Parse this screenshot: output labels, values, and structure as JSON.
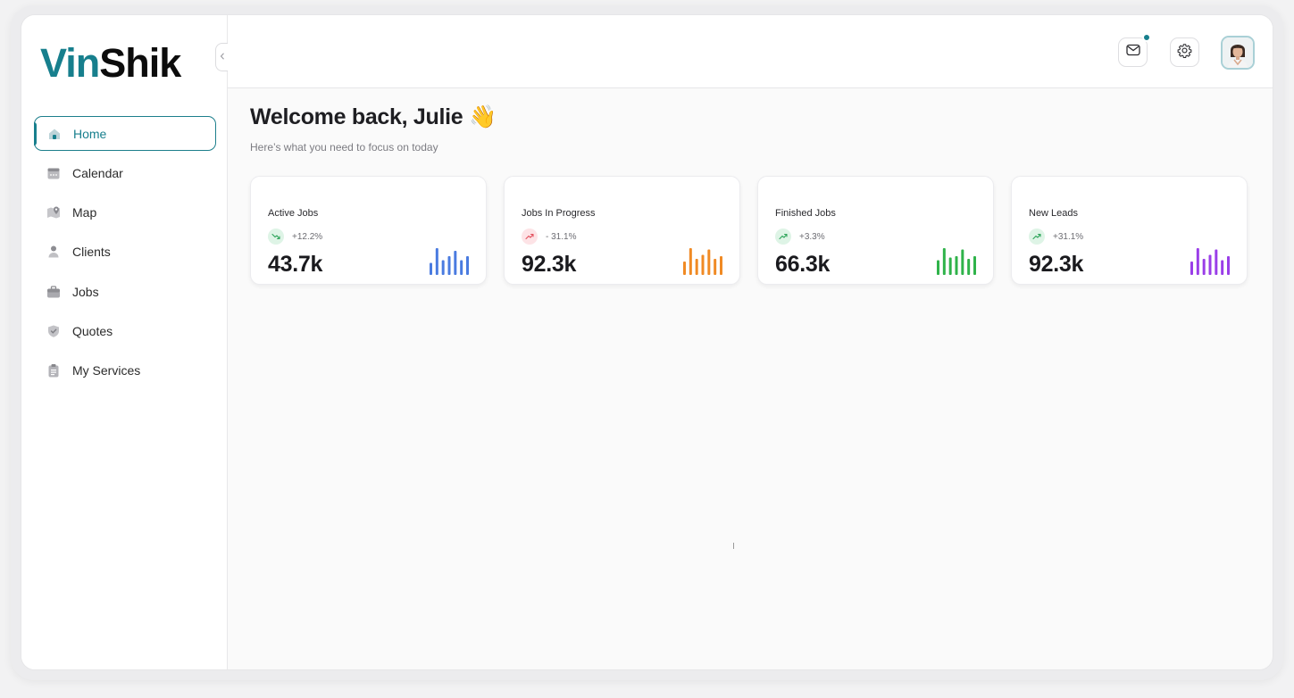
{
  "app": {
    "logo_part1": "Vin",
    "logo_part2": "Shik",
    "accent": "#177f8d"
  },
  "sidebar": {
    "collapse_icon": "chevron-left-icon",
    "items": [
      {
        "label": "Home",
        "icon": "home-icon",
        "active": true
      },
      {
        "label": "Calendar",
        "icon": "calendar-icon"
      },
      {
        "label": "Map",
        "icon": "map-icon"
      },
      {
        "label": "Clients",
        "icon": "user-icon"
      },
      {
        "label": "Jobs",
        "icon": "briefcase-icon"
      },
      {
        "label": "Quotes",
        "icon": "shield-icon"
      },
      {
        "label": "My Services",
        "icon": "clipboard-icon"
      }
    ]
  },
  "header": {
    "mail_icon": "mail-icon",
    "settings_icon": "gear-icon",
    "has_notification": true
  },
  "main": {
    "welcome": "Welcome back, Julie 👋",
    "subtitle": "Here’s what you need to focus on today"
  },
  "cards": [
    {
      "title": "Active Jobs",
      "change": "+12.2%",
      "direction": "down",
      "value": "43.7k",
      "color": "#4a7be0",
      "bars": [
        0.45,
        1.0,
        0.55,
        0.7,
        0.9,
        0.55,
        0.7
      ]
    },
    {
      "title": "Jobs In Progress",
      "change": "- 31.1%",
      "direction": "up",
      "value": "92.3k",
      "color": "#f08a24",
      "bars": [
        0.5,
        1.0,
        0.6,
        0.75,
        0.95,
        0.6,
        0.7
      ]
    },
    {
      "title": "Finished Jobs",
      "change": "+3.3%",
      "direction": "up",
      "value": "66.3k",
      "color": "#2fb34a",
      "bars": [
        0.55,
        1.0,
        0.65,
        0.7,
        0.95,
        0.6,
        0.7
      ]
    },
    {
      "title": "New Leads",
      "change": "+31.1%",
      "direction": "up",
      "value": "92.3k",
      "color": "#9a3ee8",
      "bars": [
        0.5,
        1.0,
        0.6,
        0.75,
        0.95,
        0.55,
        0.7
      ]
    }
  ]
}
